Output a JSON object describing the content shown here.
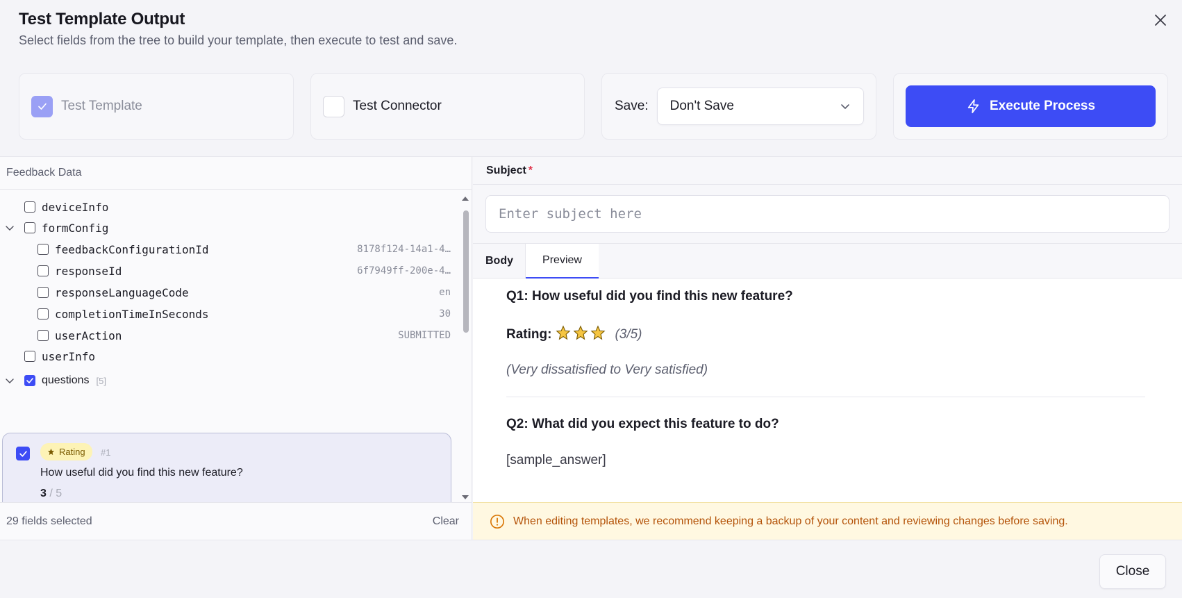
{
  "header": {
    "title": "Test Template Output",
    "subtitle": "Select fields from the tree to build your template, then execute to test and save."
  },
  "options": {
    "test_template_label": "Test Template",
    "test_template_checked": true,
    "test_connector_label": "Test Connector",
    "test_connector_checked": false,
    "save_label": "Save:",
    "save_value": "Don't Save",
    "execute_label": "Execute Process"
  },
  "tree": {
    "header": "Feedback Data",
    "rows": [
      {
        "name": "deviceInfo",
        "value": "",
        "checked": false
      },
      {
        "name": "formConfig",
        "value": "",
        "checked": false
      },
      {
        "name": "feedbackConfigurationId",
        "value": "8178f124-14a1-4…",
        "checked": false
      },
      {
        "name": "responseId",
        "value": "6f7949ff-200e-4…",
        "checked": false
      },
      {
        "name": "responseLanguageCode",
        "value": "en",
        "checked": false
      },
      {
        "name": "completionTimeInSeconds",
        "value": "30",
        "checked": false
      },
      {
        "name": "userAction",
        "value": "SUBMITTED",
        "checked": false
      },
      {
        "name": "userInfo",
        "value": "",
        "checked": false
      },
      {
        "name": "questions",
        "value": "",
        "checked": true
      }
    ],
    "questions_count": "[5]",
    "question_card": {
      "type_label": "Rating",
      "number": "#1",
      "text": "How useful did you find this new feature?",
      "score": "3",
      "score_max": "/ 5"
    },
    "footer_selected": "29 fields selected",
    "footer_clear": "Clear"
  },
  "editor": {
    "subject_label": "Subject",
    "subject_required_mark": "*",
    "subject_placeholder": "Enter subject here",
    "tabs": [
      "Body",
      "Preview"
    ],
    "active_tab": "Preview"
  },
  "preview": {
    "q1_title": "Q1: How useful did you find this new feature?",
    "rating_label": "Rating:",
    "rating_value": 3,
    "rating_text": "(3/5)",
    "rating_scale": "(Very dissatisfied to Very satisfied)",
    "q2_title": "Q2: What did you expect this feature to do?",
    "q2_answer": "[sample_answer]"
  },
  "warning": "When editing templates, we recommend keeping a backup of your content and reviewing changes before saving.",
  "footer": {
    "close_label": "Close"
  },
  "colors": {
    "accent": "#3d4cf5",
    "warning_text": "#b45309",
    "star": "#f5c542"
  }
}
